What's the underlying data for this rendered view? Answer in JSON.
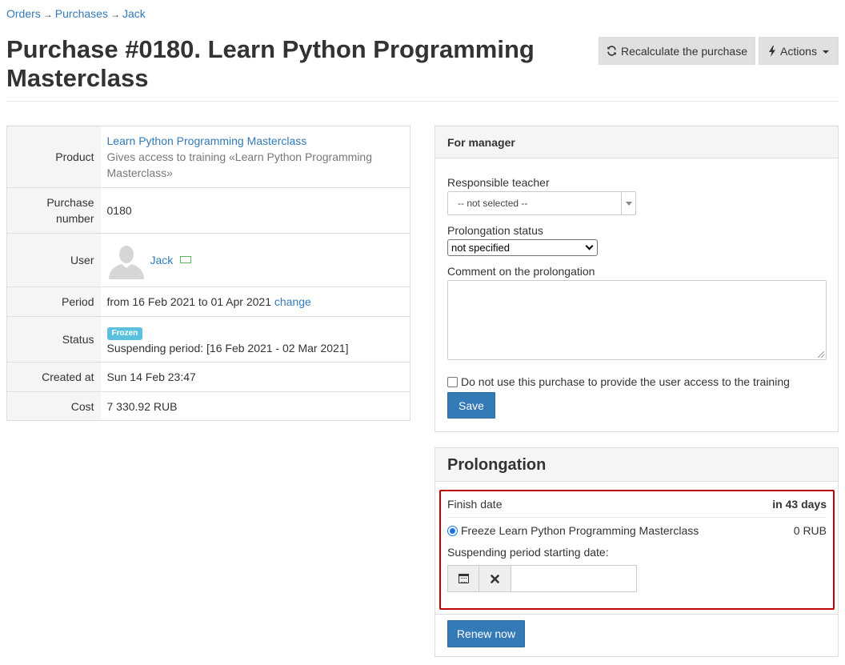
{
  "breadcrumb": {
    "items": [
      "Orders",
      "Purchases",
      "Jack"
    ],
    "separator": "→"
  },
  "header": {
    "title": "Purchase #0180. Learn Python Programming Masterclass",
    "recalc_label": "Recalculate the purchase",
    "actions_label": "Actions",
    "recalc_icon": "refresh-icon",
    "actions_icon": "bolt-icon"
  },
  "info": {
    "product_label": "Product",
    "product_name": "Learn Python Programming Masterclass",
    "product_desc": "Gives access to training «Learn Python Programming Masterclass»",
    "number_label": "Purchase number",
    "number_value": "0180",
    "user_label": "User",
    "user_name": "Jack",
    "period_label": "Period",
    "period_value": "from 16 Feb 2021 to 01 Apr 2021",
    "period_change": "change",
    "status_label": "Status",
    "status_badge": "Frozen",
    "status_detail": "Suspending period: [16 Feb 2021 - 02 Mar 2021]",
    "created_label": "Created at",
    "created_value": "Sun 14 Feb 23:47",
    "cost_label": "Cost",
    "cost_value": "7 330.92 RUB"
  },
  "manager": {
    "heading": "For manager",
    "teacher_label": "Responsible teacher",
    "teacher_value": "-- not selected --",
    "prolong_status_label": "Prolongation status",
    "prolong_status_value": "not specified",
    "comment_label": "Comment on the prolongation",
    "comment_value": "",
    "checkbox_label": "Do not use this purchase to provide the user access to the training",
    "save_label": "Save"
  },
  "prolongation": {
    "heading": "Prolongation",
    "finish_label": "Finish date",
    "finish_value": "in 43 days",
    "freeze_label": "Freeze Learn Python Programming Masterclass",
    "freeze_price": "0 RUB",
    "suspend_label": "Suspending period starting date:",
    "date_value": "",
    "renew_label": "Renew now"
  },
  "colors": {
    "link": "#337ab7",
    "primary_button": "#337ab7",
    "frozen_badge": "#5bc0de",
    "highlight_border": "#c00000"
  }
}
